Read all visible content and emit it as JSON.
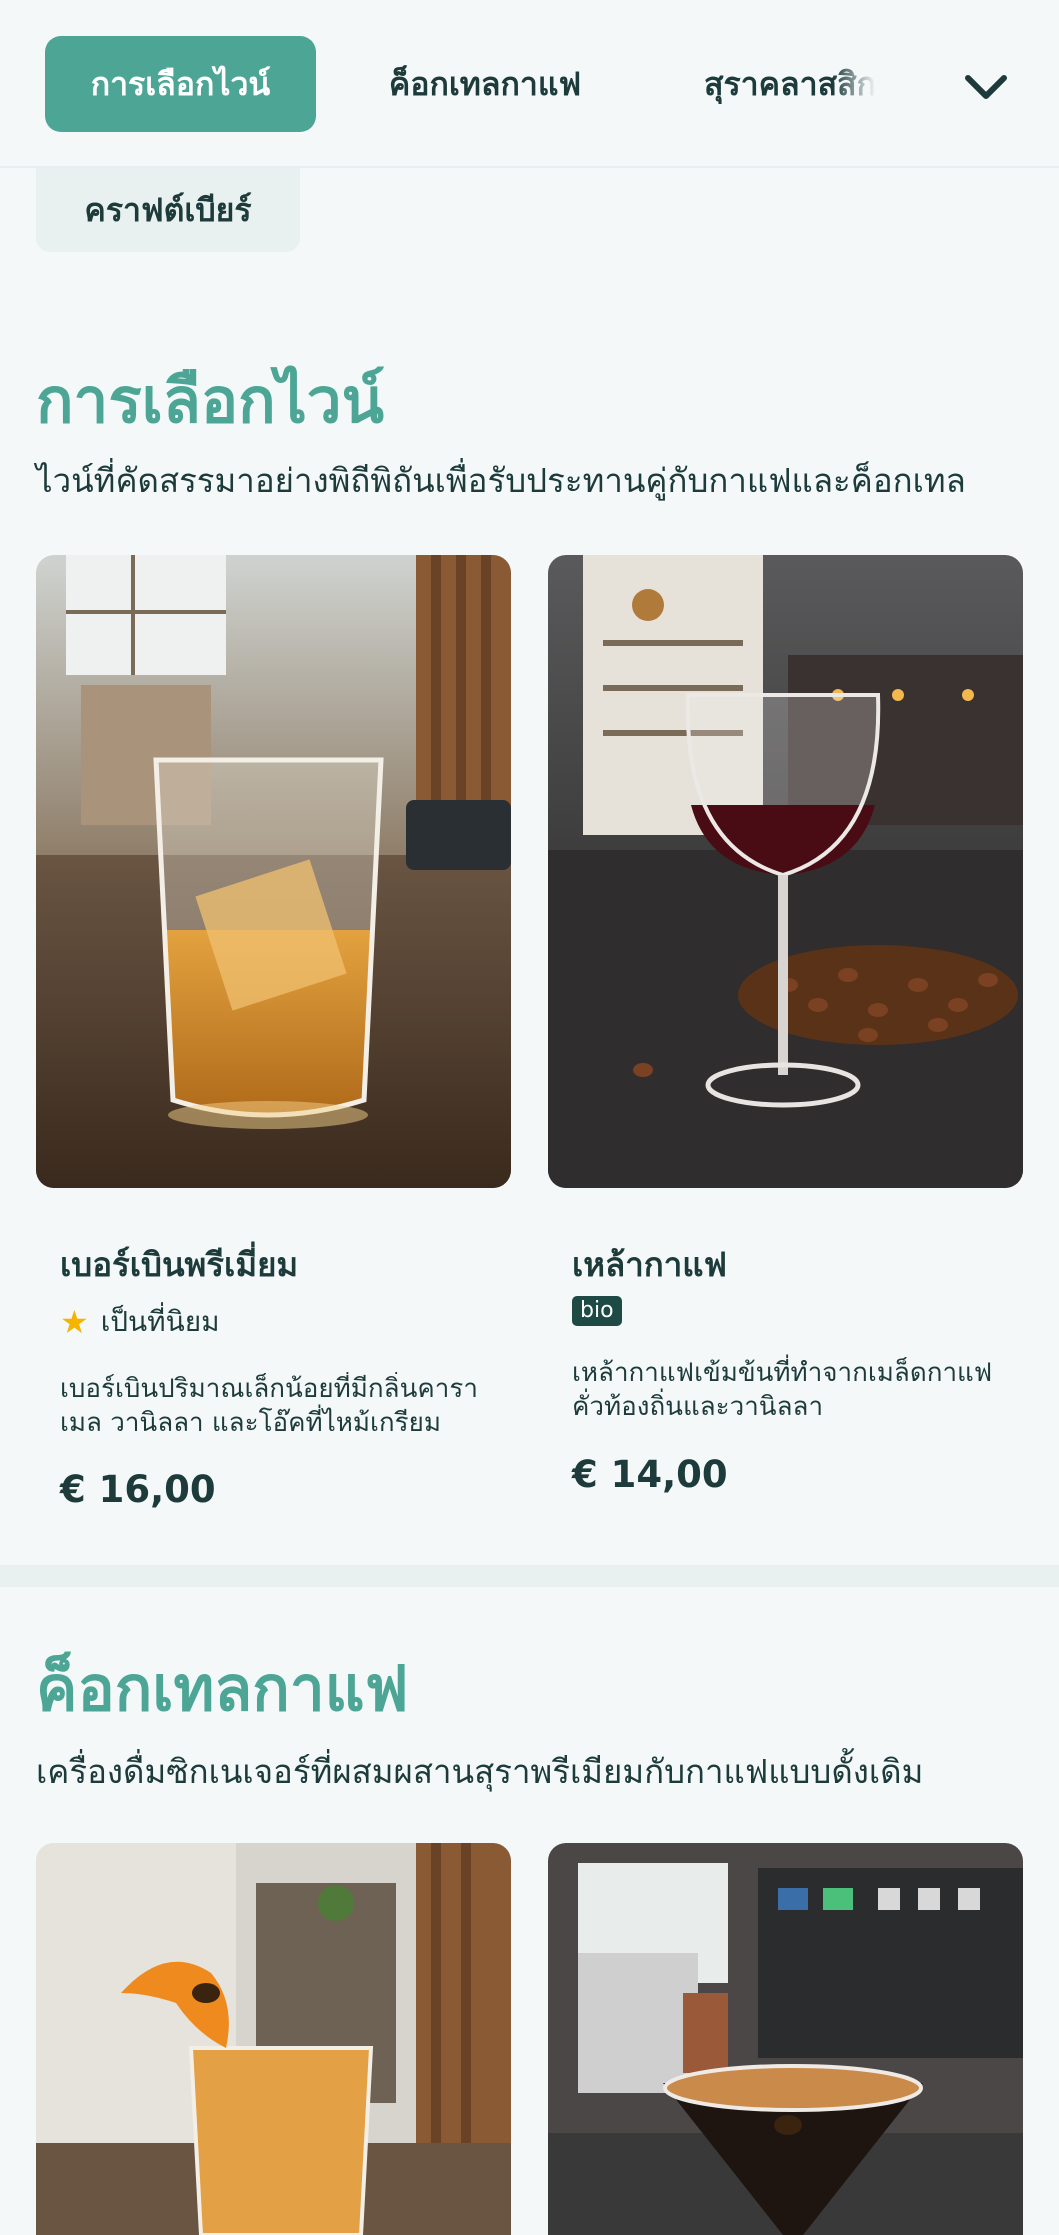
{
  "nav": {
    "tabs": [
      {
        "label": "การเลือกไวน์",
        "active": true
      },
      {
        "label": "ค็อกเทลกาแฟ",
        "active": false
      },
      {
        "label": "สุราคลาสสิก",
        "active": false
      }
    ],
    "overflow_tab": "คราฟต์เบียร์",
    "expand_icon": "chevron-down-icon"
  },
  "sections": [
    {
      "title": "การเลือกไวน์",
      "subtitle": "ไวน์ที่คัดสรรมาอย่างพิถีพิถันเพื่อรับประทานคู่กับกาแฟและค็อกเทล",
      "items": [
        {
          "name": "เบอร์เบินพรีเมี่ยม",
          "badge": "เป็นที่นิยม",
          "badge_icon": "star-icon",
          "description": "เบอร์เบินปริมาณเล็กน้อยที่มีกลิ่นคาราเมล วานิลลา และโอ๊คที่ไหม้เกรียม",
          "price": "€ 16,00"
        },
        {
          "name": "เหล้ากาแฟ",
          "badge": "bio",
          "description": "เหล้ากาแฟเข้มข้นที่ทำจากเมล็ดกาแฟคั่วท้องถิ่นและวานิลลา",
          "price": "€ 14,00"
        }
      ]
    },
    {
      "title": "ค็อกเทลกาแฟ",
      "subtitle": "เครื่องดื่มซิกเนเจอร์ที่ผสมผสานสุราพรีเมียมกับกาแฟแบบดั้งเดิม"
    }
  ],
  "colors": {
    "accent": "#4da695",
    "text": "#1d3b3b",
    "background": "#f4f8f9",
    "bio_badge": "#1d4a44",
    "star": "#f4b400"
  }
}
